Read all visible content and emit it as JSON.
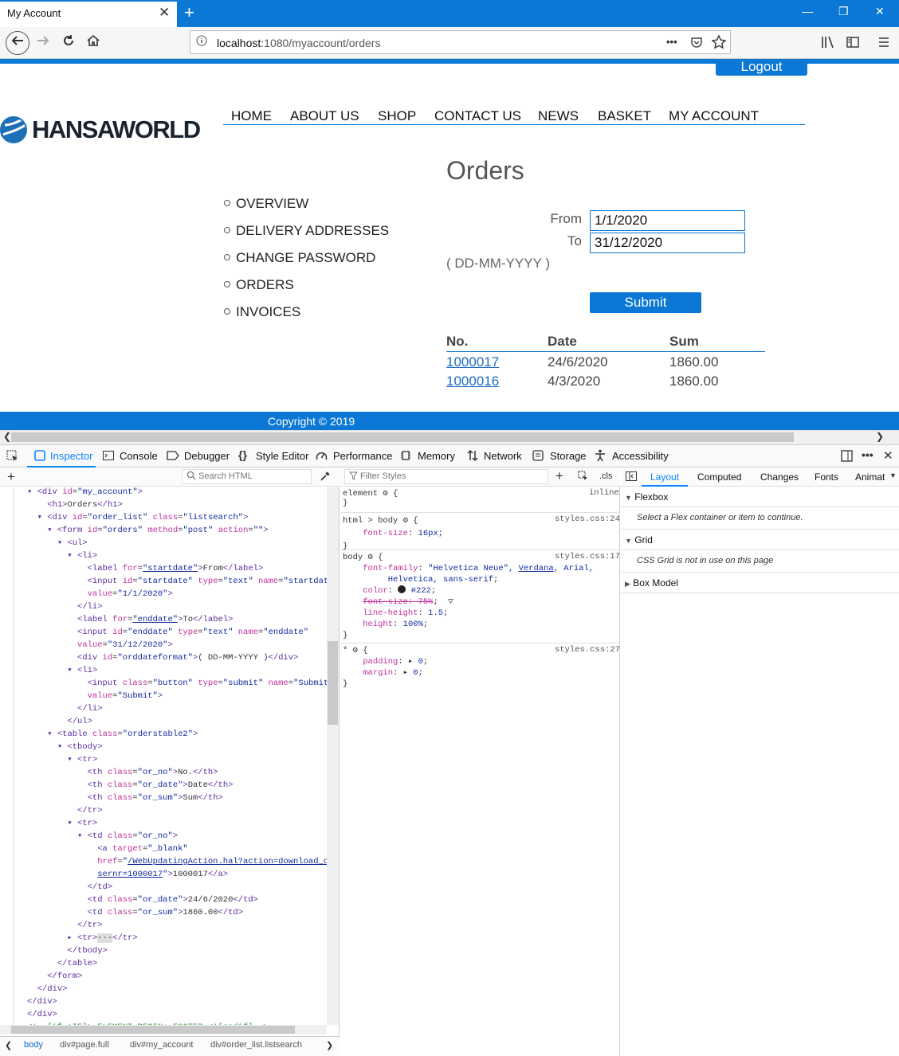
{
  "browser": {
    "tab_title": "My Account",
    "tab_close": "✕",
    "new_tab": "+",
    "window_controls": [
      "—",
      "❐",
      "✕"
    ],
    "url_prefix": "localhost",
    "url_rest": ":1080/myaccount/orders",
    "url_more": "•••"
  },
  "site": {
    "logout_label": "Logout",
    "logo_text": "HANSAWORLD",
    "menu": [
      "HOME",
      "ABOUT US",
      "SHOP",
      "CONTACT US",
      "NEWS",
      "BASKET",
      "MY ACCOUNT"
    ],
    "account_menu": [
      "OVERVIEW",
      "DELIVERY ADDRESSES",
      "CHANGE PASSWORD",
      "ORDERS",
      "INVOICES"
    ],
    "page_title": "Orders",
    "from_label": "From",
    "from_value": "1/1/2020",
    "to_label": "To",
    "to_value": "31/12/2020",
    "date_format": "( DD-MM-YYYY )",
    "submit_label": "Submit",
    "table_headers": [
      "No.",
      "Date",
      "Sum"
    ],
    "orders": [
      {
        "no": "1000017",
        "date": "24/6/2020",
        "sum": "1860.00"
      },
      {
        "no": "1000016",
        "date": "4/3/2020",
        "sum": "1860.00"
      }
    ],
    "copyright": "Copyright © 2019"
  },
  "devtools": {
    "tabs": [
      "Inspector",
      "Console",
      "Debugger",
      "Style Editor",
      "Performance",
      "Memory",
      "Network",
      "Storage",
      "Accessibility"
    ],
    "search_html_placeholder": "Search HTML",
    "filter_styles_placeholder": "Filter Styles",
    "cls_label": ".cls",
    "layout_tabs": [
      "Layout",
      "Computed",
      "Changes",
      "Fonts",
      "Animat"
    ],
    "flexbox_title": "Flexbox",
    "flexbox_msg": "Select a Flex container or item to continue.",
    "grid_title": "Grid",
    "grid_msg": "CSS Grid is not in use on this page",
    "boxmodel_title": "Box Model",
    "breadcrumbs": [
      "body",
      "div#page.full",
      "div#my_account",
      "div#order_list.listsearch"
    ],
    "rules": {
      "element_sel": "element",
      "element_src": "inline",
      "html_sel": "html > body",
      "html_src": "styles.css:24",
      "body_sel": "body",
      "body_src": "styles.css:17",
      "star_sel": "*",
      "star_src": "styles.css:27"
    }
  }
}
